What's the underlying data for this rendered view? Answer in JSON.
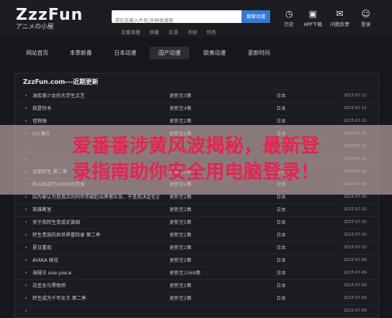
{
  "logo": {
    "main": "ZzzFun",
    "sub": "アニメの小屋"
  },
  "search": {
    "placeholder": "请在此输入片名/多种类搜索",
    "button": "搜索动漫"
  },
  "quick_links": [
    "日番周播",
    "国番",
    "日漫",
    "名剧",
    "柯南"
  ],
  "tools": [
    {
      "icon": "history-icon",
      "glyph": "◷",
      "label": "历史"
    },
    {
      "icon": "app-icon",
      "glyph": "▣",
      "label": "APP下载"
    },
    {
      "icon": "feedback-icon",
      "glyph": "✉",
      "label": "问题反馈"
    },
    {
      "icon": "user-icon",
      "glyph": "☺",
      "label": "登录"
    }
  ],
  "nav": [
    "网站首页",
    "本季新番",
    "日本动漫",
    "国产动漫",
    "欧美动漫",
    "更新时间"
  ],
  "panel": {
    "title": "ZzzFun.com---近期更新"
  },
  "rows": [
    {
      "title": "油库美少女的大学生文艺",
      "cat": "更新至3集",
      "region": "日本",
      "date": "2023-07-11"
    },
    {
      "title": "我是铃木",
      "cat": "更新至4集",
      "region": "日本",
      "date": "2023-07-11"
    },
    {
      "title": "怪物弹",
      "cat": "更新至2集",
      "region": "日本",
      "date": "2023-07-11"
    },
    {
      "title": "LV1魔王",
      "cat": "更新至2集",
      "region": "日本",
      "date": "2023-07-11"
    },
    {
      "title": "",
      "cat": "",
      "region": "",
      "date": "2023-07-11"
    },
    {
      "title": "",
      "cat": "",
      "region": "",
      "date": "2023-07-11"
    },
    {
      "title": "无职转生 第二季",
      "cat": "更新至2集",
      "region": "日本",
      "date": "2023-07-10"
    },
    {
      "title": "和山田进行LV999的恋爱",
      "cat": "更新至2集",
      "region": "日本",
      "date": "2023-07-10"
    },
    {
      "title": "因为被认为是真正的同伴而被赶出勇者队伍，于是我决定在边境悠闲度日",
      "cat": "更新至2集",
      "region": "日本",
      "date": "2023-07-10"
    },
    {
      "title": "英雄教室",
      "cat": "更新至2集",
      "region": "日本",
      "date": "2023-07-10"
    },
    {
      "title": "关于我转生变成史莱姆",
      "cat": "更新至5集",
      "region": "日本",
      "date": "2023-07-10"
    },
    {
      "title": "转生贵族的异世界冒险录 第二季",
      "cat": "更新至2集",
      "region": "日本",
      "date": "2023-07-10"
    },
    {
      "title": "夏日重现",
      "cat": "更新至2集",
      "region": "日本",
      "date": "2023-07-10"
    },
    {
      "title": "AYAKA 绫花",
      "cat": "更新至2集",
      "region": "日本",
      "date": "2023-07-09"
    },
    {
      "title": "海贼王 one piece",
      "cat": "更新至1068集",
      "region": "日本",
      "date": "2023-07-09"
    },
    {
      "title": "白圣女与黑牧师",
      "cat": "更新至2集",
      "region": "日本",
      "date": "2023-07-09"
    },
    {
      "title": "转生成为千年女王 第二季",
      "cat": "更新至2集",
      "region": "日本",
      "date": "2023-07-09"
    },
    {
      "title": "",
      "cat": "",
      "region": "",
      "date": "2023-07-09"
    }
  ],
  "banner": {
    "line1": "爱番番涉黄风波揭秘，最新登",
    "line2": "录指南助你安全用电脑登录！",
    "color": "#e8234f"
  }
}
